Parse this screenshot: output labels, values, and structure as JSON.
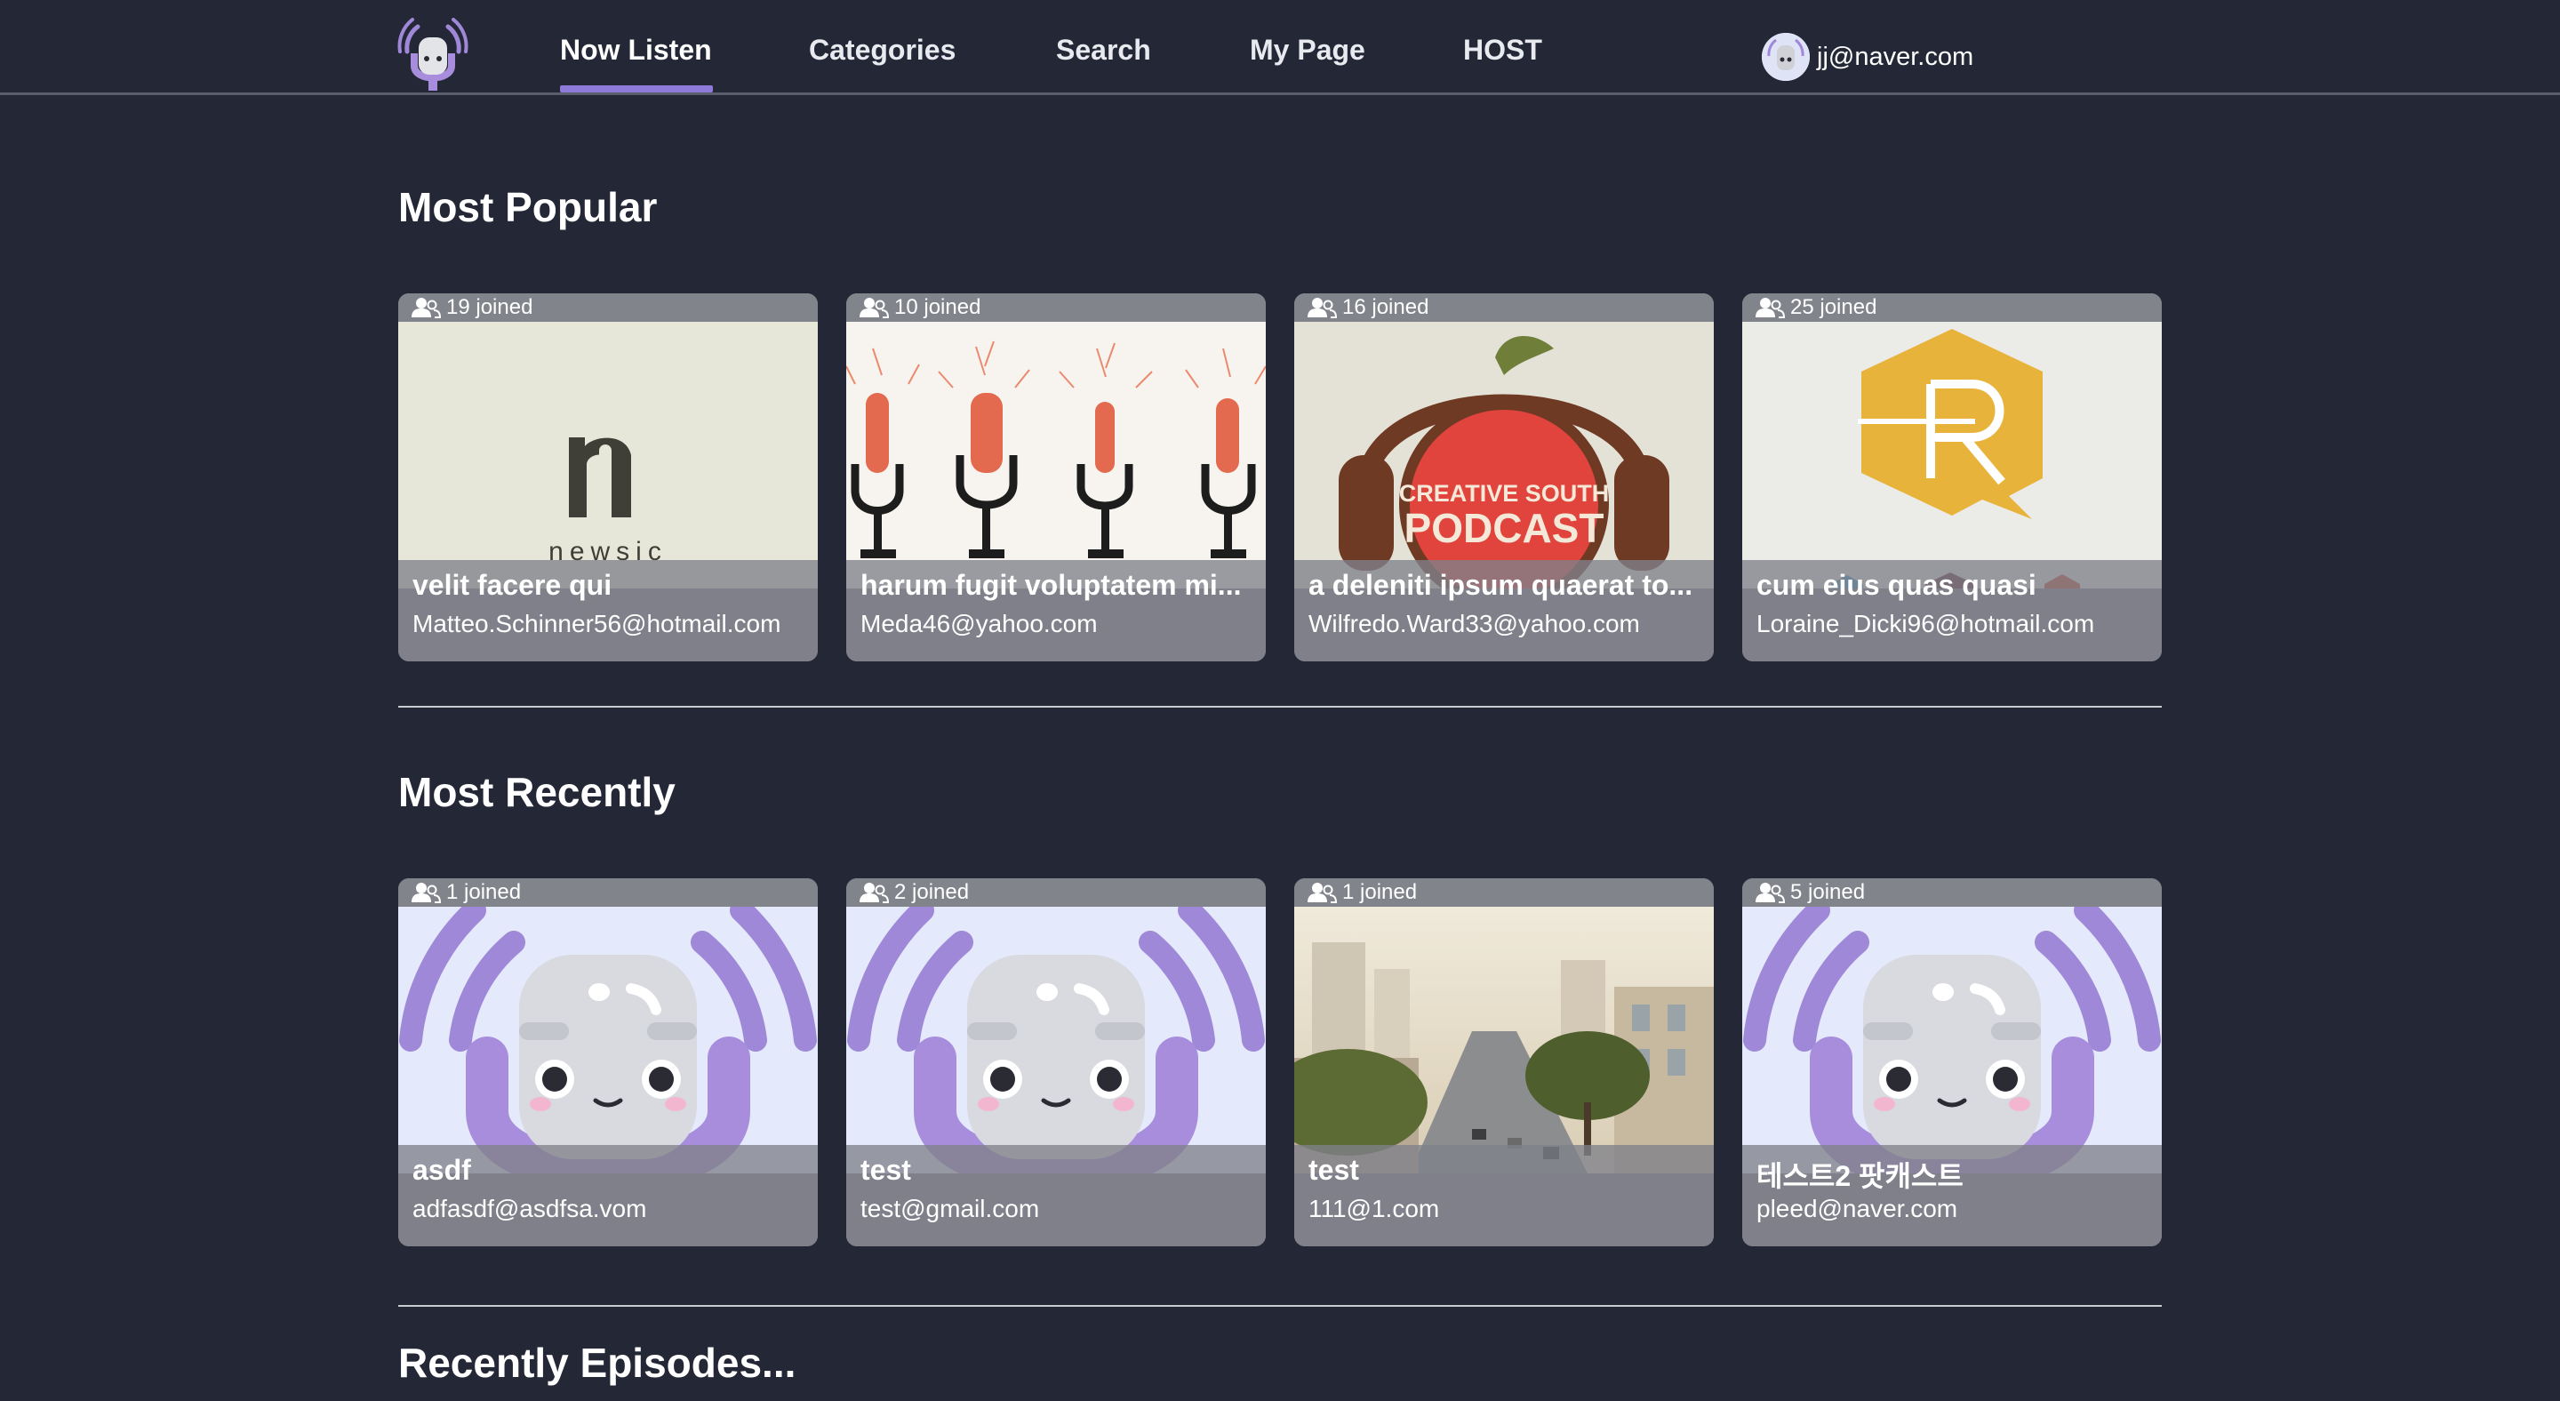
{
  "nav": {
    "items": [
      {
        "label": "Now Listen",
        "active": true
      },
      {
        "label": "Categories"
      },
      {
        "label": "Search"
      },
      {
        "label": "My Page"
      },
      {
        "label": "HOST"
      }
    ],
    "user_email": "jj@naver.com"
  },
  "popular": {
    "title": "Most Popular",
    "cards": [
      {
        "joined": "19 joined",
        "title": "velit facere qui",
        "email": "Matteo.Schinner56@hotmail.com",
        "thumb": "newsic-logo"
      },
      {
        "joined": "10 joined",
        "title": "harum fugit voluptatem mi...",
        "email": "Meda46@yahoo.com",
        "thumb": "microphones"
      },
      {
        "joined": "16 joined",
        "title": "a deleniti ipsum quaerat to...",
        "email": "Wilfredo.Ward33@yahoo.com",
        "thumb": "creative-south-podcast"
      },
      {
        "joined": "25 joined",
        "title": "cum eius quas quasi",
        "email": "Loraine_Dicki96@hotmail.com",
        "thumb": "r-hexagon-logo"
      }
    ]
  },
  "recent": {
    "title": "Most Recently",
    "cards": [
      {
        "joined": "1 joined",
        "title": "asdf",
        "email": "adfasdf@asdfsa.vom",
        "thumb": "mascot"
      },
      {
        "joined": "2 joined",
        "title": "test",
        "email": "test@gmail.com",
        "thumb": "mascot"
      },
      {
        "joined": "1 joined",
        "title": "test",
        "email": "111@1.com",
        "thumb": "city-street-photo"
      },
      {
        "joined": "5 joined",
        "title": "테스트2 팟캐스트",
        "email": "pleed@naver.com",
        "thumb": "mascot"
      }
    ]
  },
  "episodes": {
    "title": "Recently Episodes..."
  },
  "thumb_text": {
    "newsic": "newsic",
    "creative_south_line1": "CREATIVE SOUTH",
    "creative_south_line2": "PODCAST"
  },
  "colors": {
    "background": "#232736",
    "accent": "#8d7ad9",
    "card_overlay": "#80828a"
  }
}
